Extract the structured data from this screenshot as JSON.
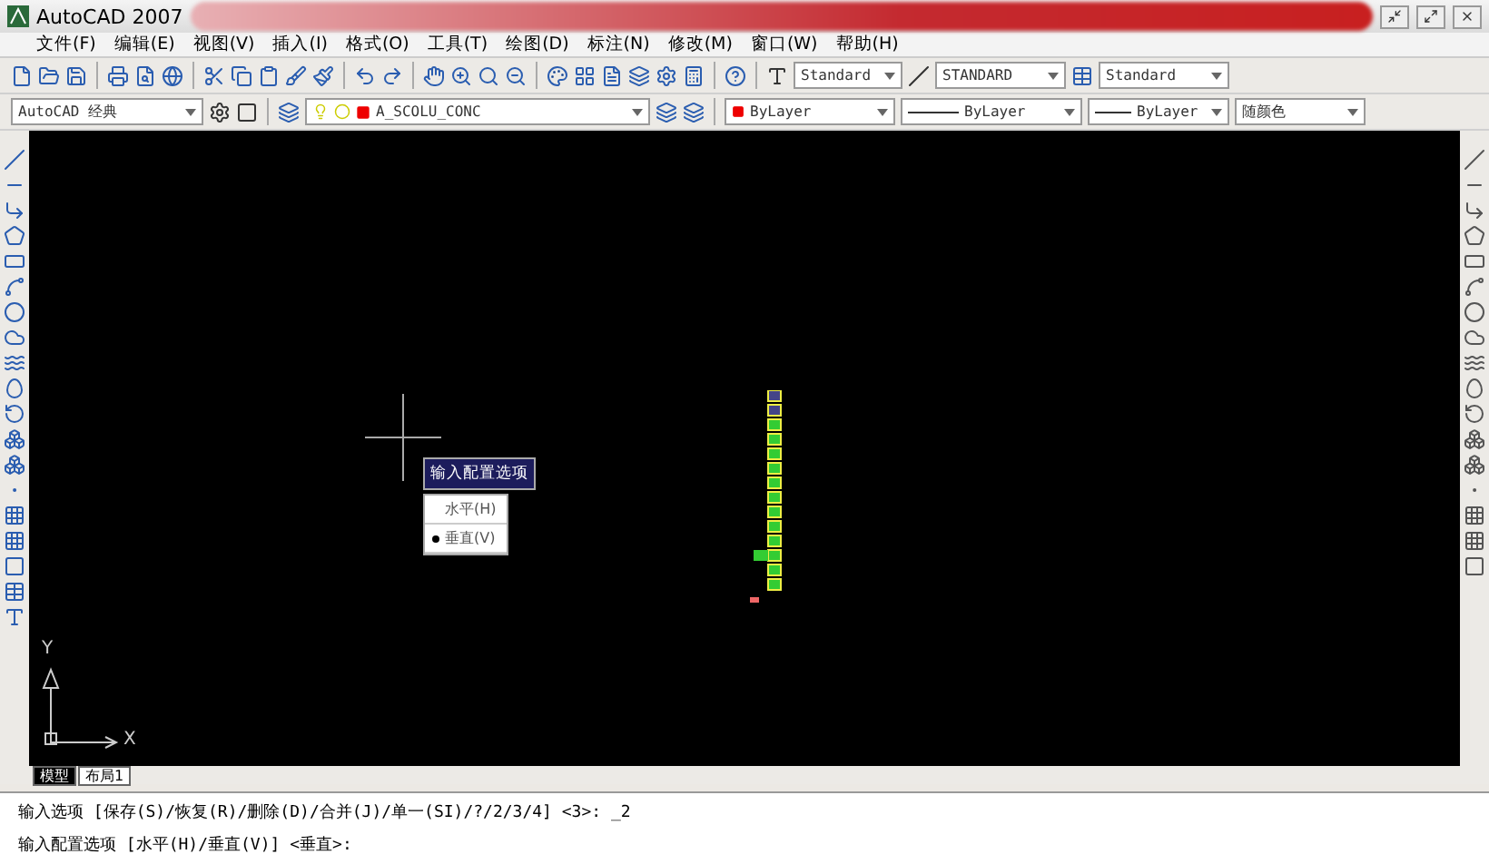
{
  "window": {
    "title": "AutoCAD 2007"
  },
  "menu": [
    "文件(F)",
    "编辑(E)",
    "视图(V)",
    "插入(I)",
    "格式(O)",
    "工具(T)",
    "绘图(D)",
    "标注(N)",
    "修改(M)",
    "窗口(W)",
    "帮助(H)"
  ],
  "styles_toolbar": {
    "text_style": "Standard",
    "dim_style": "STANDARD",
    "table_style": "Standard"
  },
  "properties_toolbar": {
    "workspace": "AutoCAD 经典",
    "layer": "A_SCOLU_CONC",
    "color_setting": "ByLayer",
    "linetype": "ByLayer",
    "lineweight": "ByLayer",
    "plot_style": "随颜色"
  },
  "popup": {
    "title": "输入配置选项",
    "options": [
      {
        "label": "水平(H)",
        "selected": false
      },
      {
        "label": "垂直(V)",
        "selected": true
      }
    ]
  },
  "ucs": {
    "y": "Y",
    "x": "X"
  },
  "tabs": [
    {
      "label": "模型",
      "selected": true
    },
    {
      "label": "布局1",
      "selected": false
    }
  ],
  "command_lines": [
    "输入选项 [保存(S)/恢复(R)/删除(D)/合并(J)/单一(SI)/?/2/3/4] <3>: _2",
    "输入配置选项 [水平(H)/垂直(V)] <垂直>:"
  ]
}
